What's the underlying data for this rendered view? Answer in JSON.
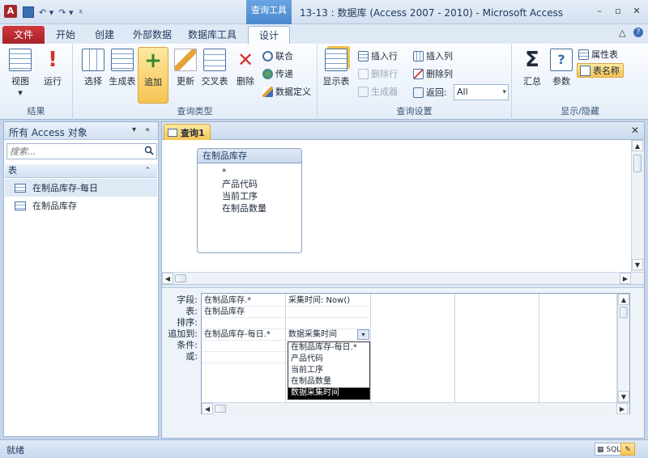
{
  "window": {
    "title": "13-13 : 数据库 (Access 2007 - 2010) - Microsoft Access",
    "context_tab": "查询工具",
    "app_icon": "A",
    "minimize": "–",
    "restore": "▫",
    "close": "✕"
  },
  "qat": {
    "undo": "↶ ▾",
    "redo": "↷ ▾",
    "customize": "⩡"
  },
  "tabs": {
    "file": "文件",
    "items": [
      "开始",
      "创建",
      "外部数据",
      "数据库工具",
      "设计"
    ],
    "active": "设计",
    "help_min": "△",
    "help": "?"
  },
  "ribbon": {
    "results": {
      "label": "结果",
      "view": "视图",
      "view_arrow": "▾",
      "run": "运行"
    },
    "query_type": {
      "label": "查询类型",
      "select": "选择",
      "make_table": "生成表",
      "append": "追加",
      "update": "更新",
      "crosstab": "交叉表",
      "delete": "删除",
      "union": "联合",
      "passthrough": "传递",
      "data_definition": "数据定义"
    },
    "query_setup": {
      "label": "查询设置",
      "show_table": "显示表",
      "insert_rows": "插入行",
      "delete_rows": "删除行",
      "builder": "生成器",
      "insert_columns": "插入列",
      "delete_columns": "删除列",
      "return": "返回:",
      "return_value": "All"
    },
    "show_hide": {
      "label": "显示/隐藏",
      "totals": "汇总",
      "parameters": "参数",
      "property_sheet": "属性表",
      "table_names": "表名称"
    }
  },
  "nav": {
    "title": "所有 Access 对象",
    "search_placeholder": "搜索...",
    "group": "表",
    "items": [
      "在制品库存-每日",
      "在制品库存"
    ]
  },
  "doc": {
    "tab": "查询1",
    "table_box": {
      "title": "在制品库存",
      "fields": [
        "*",
        "产品代码",
        "当前工序",
        "在制品数量"
      ]
    },
    "row_labels": [
      "字段:",
      "表:",
      "排序:",
      "追加到:",
      "条件:",
      "或:"
    ],
    "columns": [
      {
        "field": "在制品库存.*",
        "table": "在制品库存",
        "sort": "",
        "append_to": "在制品库存-每日.*",
        "criteria": "",
        "or": ""
      },
      {
        "field": "采集时间: Now()",
        "table": "",
        "sort": "",
        "append_to": "数据采集时间",
        "criteria": "",
        "or": ""
      }
    ],
    "dropdown_options": [
      "在制品库存-每日.*",
      "产品代码",
      "当前工序",
      "在制品数量",
      "数据采集时间"
    ],
    "dropdown_selected": "数据采集时间"
  },
  "status": {
    "text": "就绪",
    "sql_view": "SQL"
  }
}
